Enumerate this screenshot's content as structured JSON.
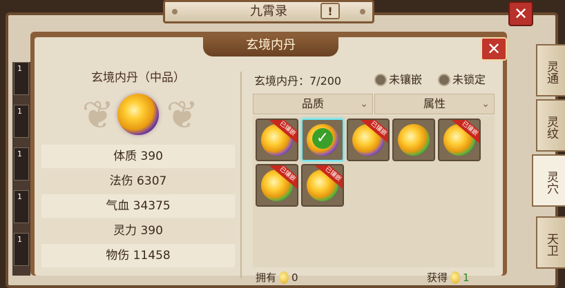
{
  "background_window": {
    "title": "九霄录",
    "help_label": "!",
    "close_label": "✕",
    "left_slot_numbers": [
      "1",
      "1",
      "1",
      "1",
      "1"
    ]
  },
  "side_tabs": [
    {
      "label": "灵通",
      "active": false
    },
    {
      "label": "灵纹",
      "active": false
    },
    {
      "label": "灵穴",
      "active": true
    },
    {
      "label": "天卫",
      "active": false
    }
  ],
  "dialog": {
    "title": "玄境内丹",
    "close_label": "✕"
  },
  "left_panel": {
    "item_name": "玄境内丹（中品）",
    "stats": [
      "体质 390",
      "法伤 6307",
      "气血 34375",
      "灵力 390",
      "物伤 11458"
    ]
  },
  "right_panel": {
    "count_label": "玄境内丹：7/200",
    "radio_unembedded": "未镶嵌",
    "radio_unlocked": "未锁定",
    "filter_quality": "品质",
    "filter_attribute": "属性",
    "gems": [
      {
        "ring": "purple",
        "embedded": true,
        "embedded_label": "已镶嵌",
        "selected": false
      },
      {
        "ring": "purple",
        "embedded": false,
        "embedded_label": "",
        "selected": true
      },
      {
        "ring": "purple",
        "embedded": true,
        "embedded_label": "已镶嵌",
        "selected": false
      },
      {
        "ring": "green",
        "embedded": false,
        "embedded_label": "",
        "selected": false
      },
      {
        "ring": "green",
        "embedded": true,
        "embedded_label": "已镶嵌",
        "selected": false
      },
      {
        "ring": "green",
        "embedded": true,
        "embedded_label": "已镶嵌",
        "selected": false
      },
      {
        "ring": "green",
        "embedded": true,
        "embedded_label": "已镶嵌",
        "selected": false
      }
    ],
    "own_label": "拥有",
    "own_value": "0",
    "gain_label": "获得",
    "gain_value": "1"
  }
}
